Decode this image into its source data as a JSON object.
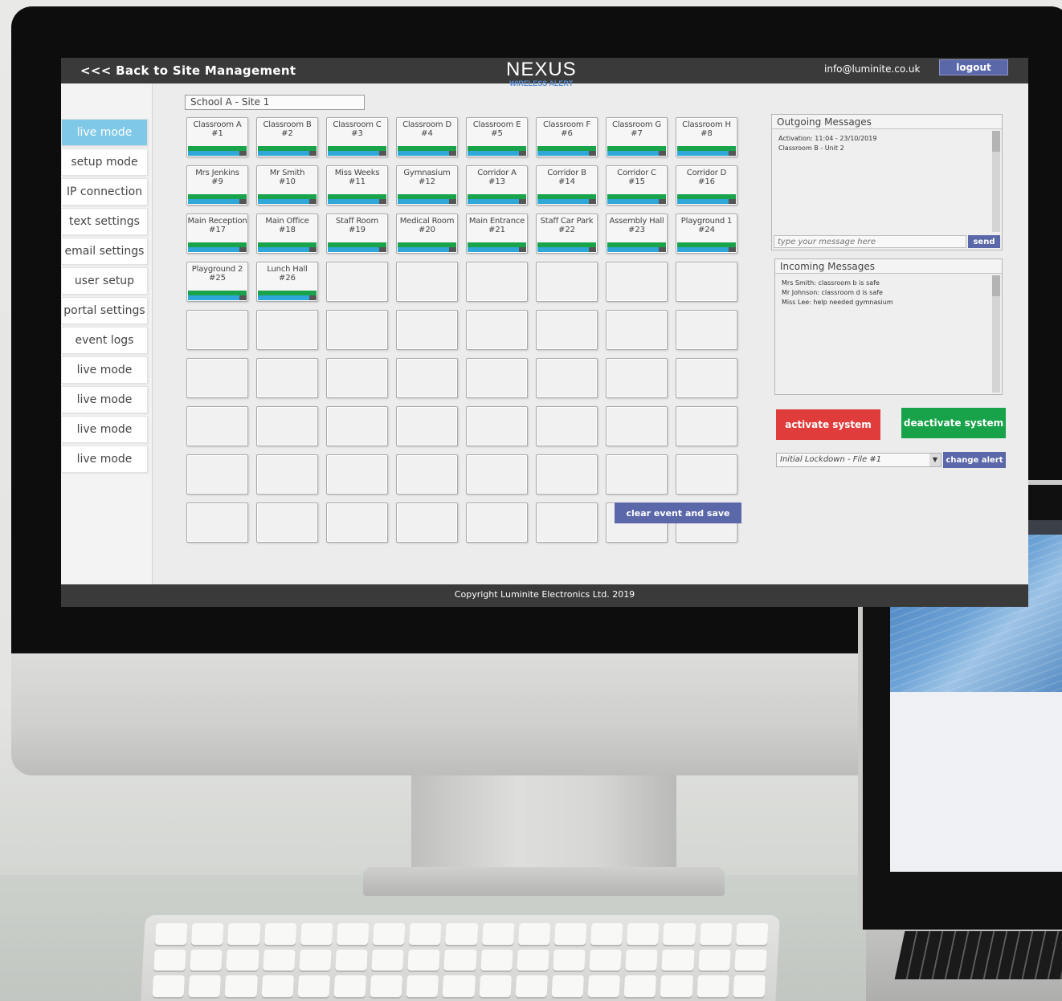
{
  "header": {
    "back_link": "<<< Back to Site Management",
    "logo_main": "NEXUS",
    "logo_sub": "WIRELESS ALERT",
    "email": "info@luminite.co.uk",
    "logout_label": "logout"
  },
  "sidebar": {
    "items": [
      {
        "label": "live mode",
        "active": true
      },
      {
        "label": "setup mode"
      },
      {
        "label": "IP connection"
      },
      {
        "label": "text settings"
      },
      {
        "label": "email settings"
      },
      {
        "label": "user setup"
      },
      {
        "label": "portal settings"
      },
      {
        "label": "event logs"
      },
      {
        "label": "live mode"
      },
      {
        "label": "live mode"
      },
      {
        "label": "live mode"
      },
      {
        "label": "live mode"
      }
    ]
  },
  "site_select": {
    "value": "School A - Site 1"
  },
  "tiles": [
    {
      "name": "Classroom A",
      "num": "#1"
    },
    {
      "name": "Classroom B",
      "num": "#2"
    },
    {
      "name": "Classroom C",
      "num": "#3"
    },
    {
      "name": "Classroom D",
      "num": "#4"
    },
    {
      "name": "Classroom E",
      "num": "#5"
    },
    {
      "name": "Classroom F",
      "num": "#6"
    },
    {
      "name": "Classroom G",
      "num": "#7"
    },
    {
      "name": "Classroom H",
      "num": "#8"
    },
    {
      "name": "Mrs Jenkins",
      "num": "#9"
    },
    {
      "name": "Mr Smith",
      "num": "#10"
    },
    {
      "name": "Miss Weeks",
      "num": "#11"
    },
    {
      "name": "Gymnasium",
      "num": "#12"
    },
    {
      "name": "Corridor A",
      "num": "#13"
    },
    {
      "name": "Corridor B",
      "num": "#14"
    },
    {
      "name": "Corridor C",
      "num": "#15"
    },
    {
      "name": "Corridor D",
      "num": "#16"
    },
    {
      "name": "Main Reception",
      "num": "#17"
    },
    {
      "name": "Main Office",
      "num": "#18"
    },
    {
      "name": "Staff Room",
      "num": "#19"
    },
    {
      "name": "Medical Room",
      "num": "#20"
    },
    {
      "name": "Main Entrance",
      "num": "#21"
    },
    {
      "name": "Staff Car Park",
      "num": "#22"
    },
    {
      "name": "Assembly Hall",
      "num": "#23"
    },
    {
      "name": "Playground 1",
      "num": "#24"
    },
    {
      "name": "Playground 2",
      "num": "#25"
    },
    {
      "name": "Lunch Hall",
      "num": "#26"
    }
  ],
  "empty_tile_count": 46,
  "clear_button": "clear event and save",
  "outgoing": {
    "title": "Outgoing Messages",
    "lines": [
      "Activation: 11:04 - 23/10/2019",
      "Classroom B - Unit 2"
    ],
    "placeholder": "type your message here",
    "send_label": "send"
  },
  "incoming": {
    "title": "Incoming Messages",
    "lines": [
      "Mrs Smith: classroom b is safe",
      "Mr Johnson: classroom d is safe",
      "Miss Lee: help needed gymnasium"
    ]
  },
  "activate_label": "activate system",
  "deactivate_label": "deactivate system",
  "alert_file": {
    "value": "Initial Lockdown - File #1"
  },
  "change_alert_label": "change alert",
  "footer": "Copyright Luminite Electronics Ltd. 2019",
  "colors": {
    "accent": "#5a67a8",
    "active_nav": "#7fc8e8",
    "activate": "#e13c3c",
    "deactivate": "#18a34a",
    "status_green": "#19a34a",
    "status_blue": "#2fa7d8"
  }
}
